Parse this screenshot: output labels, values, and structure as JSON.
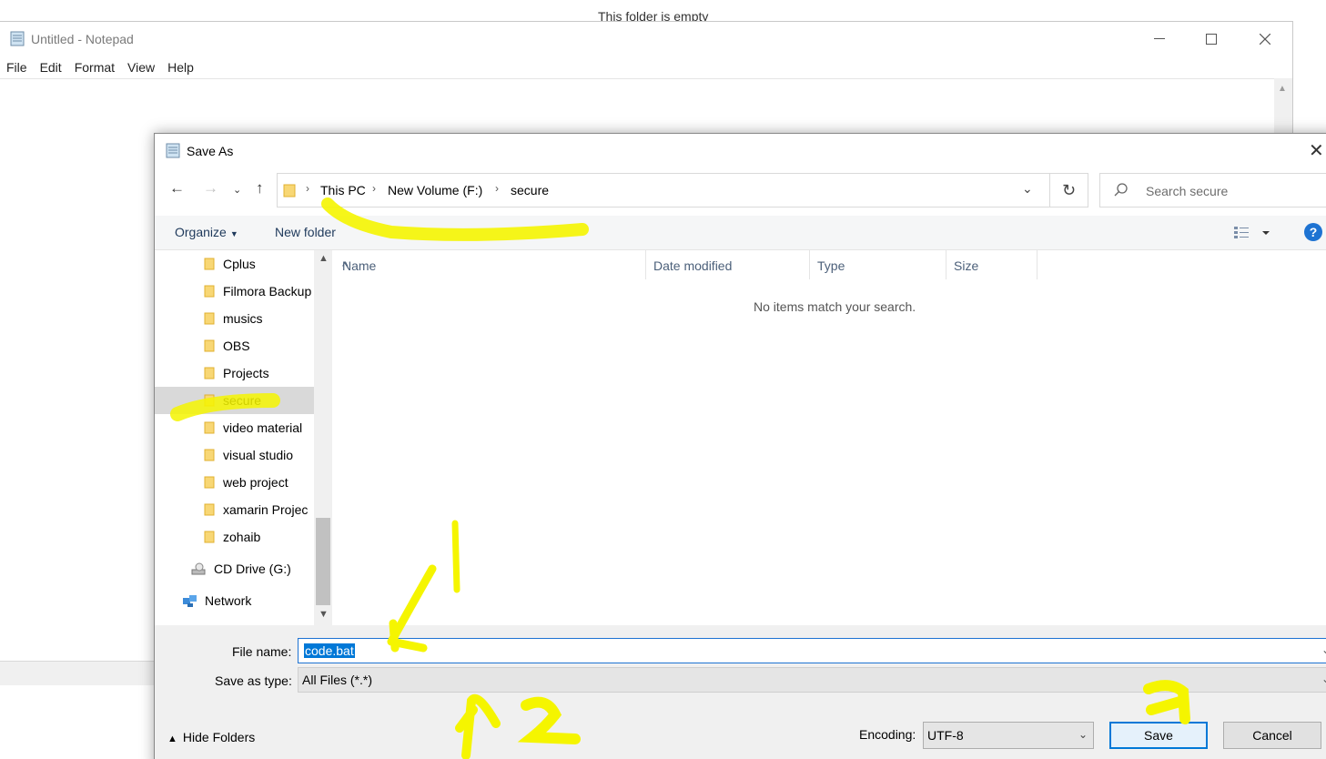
{
  "background": {
    "caption": "This folder is empty"
  },
  "notepad": {
    "title": "Untitled - Notepad",
    "menu": [
      "File",
      "Edit",
      "Format",
      "View",
      "Help"
    ],
    "window_controls": [
      "minimize-icon",
      "maximize-icon",
      "close-icon"
    ]
  },
  "dialog": {
    "title": "Save As",
    "address": {
      "segments": [
        "This PC",
        "New Volume (F:)",
        "secure"
      ]
    },
    "search": {
      "placeholder": "Search secure"
    },
    "toolbar": {
      "organize": "Organize",
      "new_folder": "New folder",
      "help": "?"
    },
    "tree": [
      {
        "label": "Cplus",
        "icon": "folder-icon"
      },
      {
        "label": "Filmora Backup",
        "icon": "folder-icon"
      },
      {
        "label": "musics",
        "icon": "folder-icon"
      },
      {
        "label": "OBS",
        "icon": "folder-icon"
      },
      {
        "label": "Projects",
        "icon": "folder-icon"
      },
      {
        "label": "secure",
        "icon": "folder-icon",
        "selected": true
      },
      {
        "label": "video material",
        "icon": "folder-icon"
      },
      {
        "label": "visual studio",
        "icon": "folder-icon"
      },
      {
        "label": "web project",
        "icon": "folder-icon"
      },
      {
        "label": "xamarin Projec",
        "icon": "folder-icon"
      },
      {
        "label": "zohaib",
        "icon": "folder-icon"
      },
      {
        "label": "CD Drive (G:)",
        "icon": "cd-drive-icon"
      },
      {
        "label": "Network",
        "icon": "network-icon"
      }
    ],
    "columns": [
      "Name",
      "Date modified",
      "Type",
      "Size"
    ],
    "empty_message": "No items match your search.",
    "file_name_label": "File name:",
    "file_name_value": "code.bat",
    "save_type_label": "Save as type:",
    "save_type_value": "All Files  (*.*)",
    "hide_folders": "Hide Folders",
    "encoding_label": "Encoding:",
    "encoding_value": "UTF-8",
    "save_button": "Save",
    "cancel_button": "Cancel"
  },
  "colors": {
    "accent": "#0078d7",
    "highlighter": "#f5f500",
    "selection": "#d9d9d9"
  }
}
